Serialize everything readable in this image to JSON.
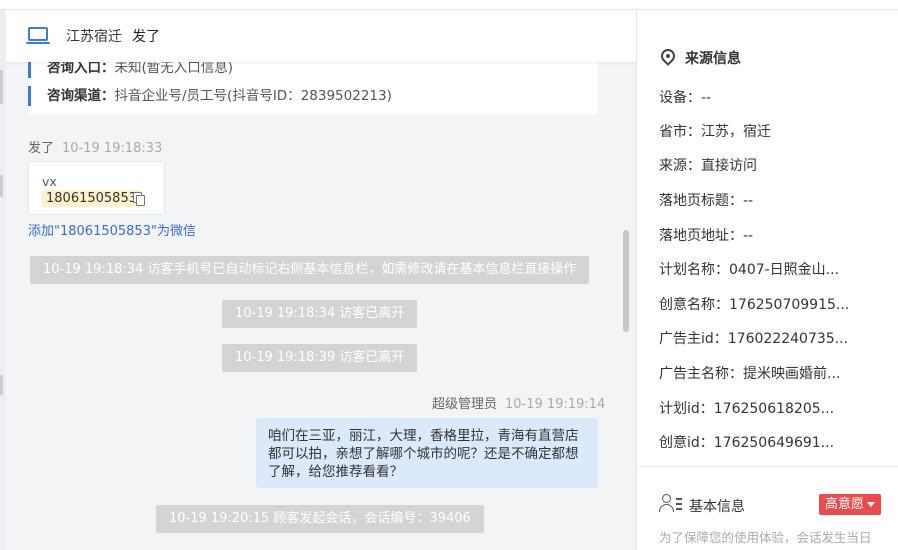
{
  "header": {
    "location": "江苏宿迁",
    "message": "发了"
  },
  "info_card": {
    "row1_label": "咨询入口：",
    "row1_value": "未知(暂无入口信息)",
    "row2_label": "咨询渠道：",
    "row2_value": "抖音企业号/员工号(抖音号ID：2839502213)"
  },
  "messages": {
    "visitor_name": "发了",
    "visitor_time": "10-19 19:18:33",
    "vx_label": "vx",
    "vx_number": "18061505853",
    "add_wechat": "添加\"18061505853\"为微信",
    "sys1": "10-19 19:18:34 访客手机号已自动标记右侧基本信息栏，如需修改请在基本信息栏直接操作",
    "sys2": "10-19 19:18:34 访客已离开",
    "sys3": "10-19 19:18:39 访客已离开",
    "agent_name": "超级管理员",
    "agent_time": "10-19 19:19:14",
    "agent_text": "咱们在三亚，丽江，大理，香格里拉，青海有直营店都可以拍，亲想了解哪个城市的呢？还是不确定都想了解，给您推荐看看？",
    "sys4": "10-19 19:20:15 顾客发起会话，会话编号：39406"
  },
  "source_info": {
    "title": "来源信息",
    "device": "设备：--",
    "province": "省市：江苏，宿迁",
    "source": "来源：直接访问",
    "landing_title": "落地页标题：--",
    "landing_url": "落地页地址：--",
    "plan_name": "计划名称：0407-日照金山...",
    "creative_name": "创意名称：176250709915...",
    "advertiser_id": "广告主id：176022240735...",
    "advertiser_name": "广告主名称：提米映画婚前...",
    "plan_id": "计划id：176250618205...",
    "creative_id": "创意id：176250649691..."
  },
  "basic_info": {
    "title": "基本信息",
    "intent_badge": "高意愿",
    "notice": "为了保障您的使用体验，会话发生当日"
  },
  "colors": {
    "accent": "#3d7bd9",
    "badge": "#e84c4c",
    "agent_bubble": "#dce9fb",
    "system_pill": "#d4d4d4"
  }
}
